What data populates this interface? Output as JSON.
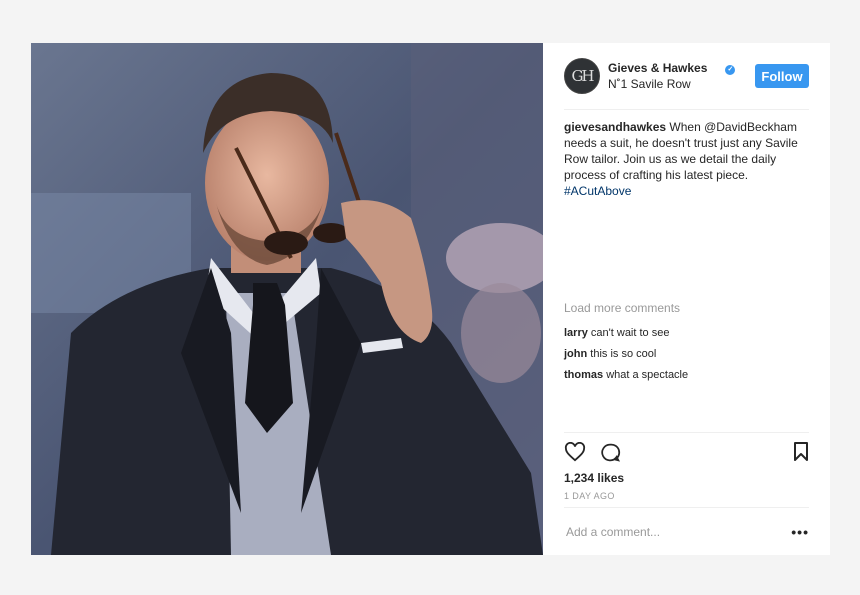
{
  "account": {
    "avatar_initials": "GH",
    "display_name": "Gieves & Hawkes",
    "subtitle": "N˚1 Savile Row",
    "verified": true
  },
  "follow_label": "Follow",
  "caption": {
    "username": "gievesandhawkes",
    "text": "When @DavidBeckham needs a suit, he doesn't trust just any Savile Row tailor. Join us as we detail the daily process of crafting his latest piece.",
    "hashtag": "#ACutAbove"
  },
  "load_more": "Load more comments",
  "comments": [
    {
      "user": "larry",
      "text": "can't wait to see"
    },
    {
      "user": "john",
      "text": "this is so cool"
    },
    {
      "user": "thomas",
      "text": "what a spectacle"
    }
  ],
  "likes": "1,234 likes",
  "time_ago": "1 DAY AGO",
  "add_comment_placeholder": "Add a comment...",
  "more_options": "•••",
  "colors": {
    "accent": "#3897f0",
    "hashtag": "#003569",
    "muted": "#999999"
  },
  "icons": [
    "heart-icon",
    "comment-icon",
    "bookmark-icon",
    "more-options-icon",
    "verified-icon"
  ]
}
